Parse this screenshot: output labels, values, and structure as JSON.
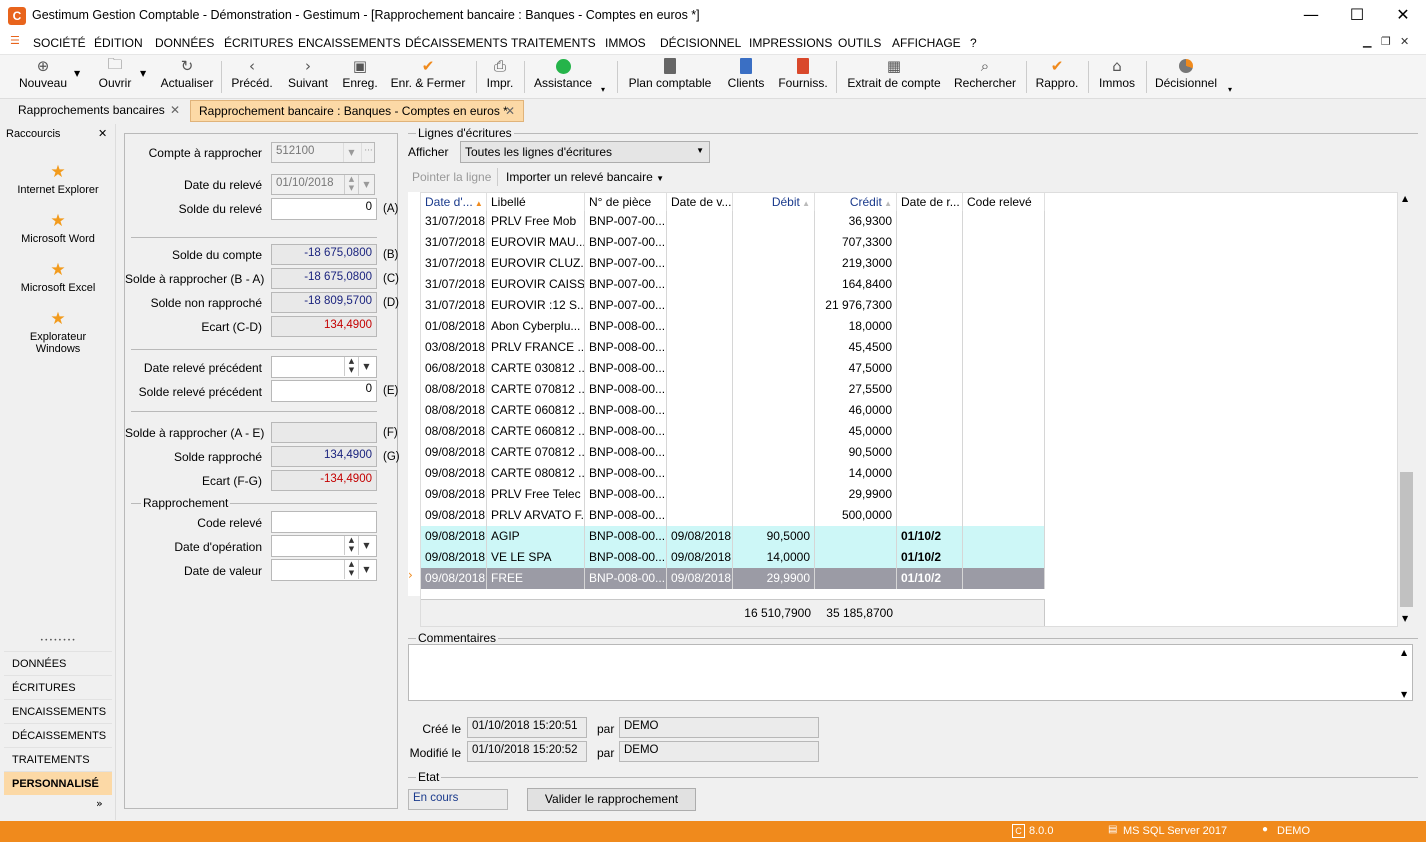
{
  "window": {
    "title": "Gestimum Gestion Comptable - Démonstration - Gestimum - [Rapprochement bancaire : Banques - Comptes en euros *]",
    "app_icon": "C"
  },
  "menu": [
    "SOCIÉTÉ",
    "ÉDITION",
    "DONNÉES",
    "ÉCRITURES",
    "ENCAISSEMENTS",
    "DÉCAISSEMENTS",
    "TRAITEMENTS",
    "IMMOS",
    "DÉCISIONNEL",
    "IMPRESSIONS",
    "OUTILS",
    "AFFICHAGE",
    "?"
  ],
  "toolbar": {
    "nouveau": "Nouveau",
    "ouvrir": "Ouvrir",
    "actualiser": "Actualiser",
    "preced": "Précéd.",
    "suivant": "Suivant",
    "enreg": "Enreg.",
    "enr_fermer": "Enr. & Fermer",
    "impr": "Impr.",
    "assistance": "Assistance",
    "plan": "Plan comptable",
    "clients": "Clients",
    "fourniss": "Fourniss.",
    "extrait": "Extrait de compte",
    "rechercher": "Rechercher",
    "rappro": "Rappro.",
    "immos": "Immos",
    "decisionnel": "Décisionnel"
  },
  "tabs": [
    {
      "label": "Rapprochements bancaires"
    },
    {
      "label": "Rapprochement bancaire : Banques - Comptes en euros *"
    }
  ],
  "shortcuts": {
    "title": "Raccourcis",
    "items": [
      "Internet Explorer",
      "Microsoft Word",
      "Microsoft Excel",
      "Explorateur Windows"
    ],
    "more": "••••••••"
  },
  "nav": [
    "DONNÉES",
    "ÉCRITURES",
    "ENCAISSEMENTS",
    "DÉCAISSEMENTS",
    "TRAITEMENTS",
    "PERSONNALISÉ"
  ],
  "form": {
    "compte_label": "Compte à rapprocher",
    "compte_value": "512100",
    "date_releve_label": "Date du relevé",
    "date_releve_value": "01/10/2018",
    "solde_releve_label": "Solde du relevé",
    "solde_releve_value": "0",
    "suffix_a": "(A)",
    "solde_compte_label": "Solde du compte",
    "solde_compte_value": "-18 675,0800",
    "suffix_b": "(B)",
    "solde_rapprocher_label": "Solde à rapprocher (B - A)",
    "solde_rapprocher_value": "-18 675,0800",
    "suffix_c": "(C)",
    "solde_non_label": "Solde non rapproché",
    "solde_non_value": "-18 809,5700",
    "suffix_d": "(D)",
    "ecart_cd_label": "Ecart (C-D)",
    "ecart_cd_value": "134,4900",
    "date_prec_label": "Date relevé précédent",
    "date_prec_value": "",
    "solde_prec_label": "Solde relevé précédent",
    "solde_prec_value": "0",
    "suffix_e": "(E)",
    "solde_ae_label": "Solde à rapprocher (A - E)",
    "solde_ae_value": "",
    "suffix_f": "(F)",
    "solde_rappr_label": "Solde rapproché",
    "solde_rappr_value": "134,4900",
    "suffix_g": "(G)",
    "ecart_fg_label": "Ecart (F-G)",
    "ecart_fg_value": "-134,4900",
    "rappro_group": "Rapprochement",
    "code_releve_label": "Code relevé",
    "date_op_label": "Date d'opération",
    "date_val_label": "Date de valeur"
  },
  "lines": {
    "group": "Lignes d'écritures",
    "afficher_label": "Afficher",
    "afficher_value": "Toutes les lignes d'écritures",
    "pointer": "Pointer la ligne",
    "importer": "Importer un relevé bancaire",
    "columns": [
      "Date d'...",
      "Libellé",
      "N° de pièce",
      "Date de v...",
      "Débit",
      "Crédit",
      "Date de r...",
      "Code relevé"
    ],
    "rows": [
      [
        "31/07/2018",
        "PRLV Free Mob",
        "BNP-007-00...",
        "",
        "",
        "36,9300",
        "",
        ""
      ],
      [
        "31/07/2018",
        "EUROVIR MAU...",
        "BNP-007-00...",
        "",
        "",
        "707,3300",
        "",
        ""
      ],
      [
        "31/07/2018",
        "EUROVIR CLUZ...",
        "BNP-007-00...",
        "",
        "",
        "219,3000",
        "",
        ""
      ],
      [
        "31/07/2018",
        "EUROVIR CAISS...",
        "BNP-007-00...",
        "",
        "",
        "164,8400",
        "",
        ""
      ],
      [
        "31/07/2018",
        "EUROVIR :12 S...",
        "BNP-007-00...",
        "",
        "",
        "21 976,7300",
        "",
        ""
      ],
      [
        "01/08/2018",
        "Abon Cyberplu...",
        "BNP-008-00...",
        "",
        "",
        "18,0000",
        "",
        ""
      ],
      [
        "03/08/2018",
        "PRLV FRANCE ...",
        "BNP-008-00...",
        "",
        "",
        "45,4500",
        "",
        ""
      ],
      [
        "06/08/2018",
        "CARTE 030812 ...",
        "BNP-008-00...",
        "",
        "",
        "47,5000",
        "",
        ""
      ],
      [
        "08/08/2018",
        "CARTE 070812 ...",
        "BNP-008-00...",
        "",
        "",
        "27,5500",
        "",
        ""
      ],
      [
        "08/08/2018",
        "CARTE 060812 ...",
        "BNP-008-00...",
        "",
        "",
        "46,0000",
        "",
        ""
      ],
      [
        "08/08/2018",
        "CARTE 060812 ...",
        "BNP-008-00...",
        "",
        "",
        "45,0000",
        "",
        ""
      ],
      [
        "09/08/2018",
        "CARTE 070812 ...",
        "BNP-008-00...",
        "",
        "",
        "90,5000",
        "",
        ""
      ],
      [
        "09/08/2018",
        "CARTE 080812 ...",
        "BNP-008-00...",
        "",
        "",
        "14,0000",
        "",
        ""
      ],
      [
        "09/08/2018",
        "PRLV Free Telec",
        "BNP-008-00...",
        "",
        "",
        "29,9900",
        "",
        ""
      ],
      [
        "09/08/2018",
        "PRLV ARVATO F...",
        "BNP-008-00...",
        "",
        "",
        "500,0000",
        "",
        ""
      ],
      [
        "09/08/2018",
        "AGIP",
        "BNP-008-00...",
        "09/08/2018",
        "90,5000",
        "",
        "01/10/2",
        ""
      ],
      [
        "09/08/2018",
        "VE LE SPA",
        "BNP-008-00...",
        "09/08/2018",
        "14,0000",
        "",
        "01/10/2",
        ""
      ],
      [
        "09/08/2018",
        "FREE",
        "BNP-008-00...",
        "09/08/2018",
        "29,9900",
        "",
        "01/10/2",
        ""
      ]
    ],
    "total_debit": "16 510,7900",
    "total_credit": "35 185,8700"
  },
  "comments": {
    "label": "Commentaires",
    "value": ""
  },
  "meta": {
    "cree_label": "Créé le",
    "cree_value": "01/10/2018 15:20:51",
    "par": "par",
    "cree_par": "DEMO",
    "modif_label": "Modifié le",
    "modif_value": "01/10/2018 15:20:52",
    "modif_par": "DEMO"
  },
  "etat": {
    "label": "Etat",
    "value": "En cours",
    "button": "Valider le rapprochement"
  },
  "status": {
    "version": "8.0.0",
    "db": "MS SQL Server 2017",
    "user": "DEMO"
  },
  "colors": {
    "accent": "#f08a1c",
    "selected_row": "#cdf7f7",
    "current_row": "#9b9ba5",
    "negative": "#c40000"
  }
}
